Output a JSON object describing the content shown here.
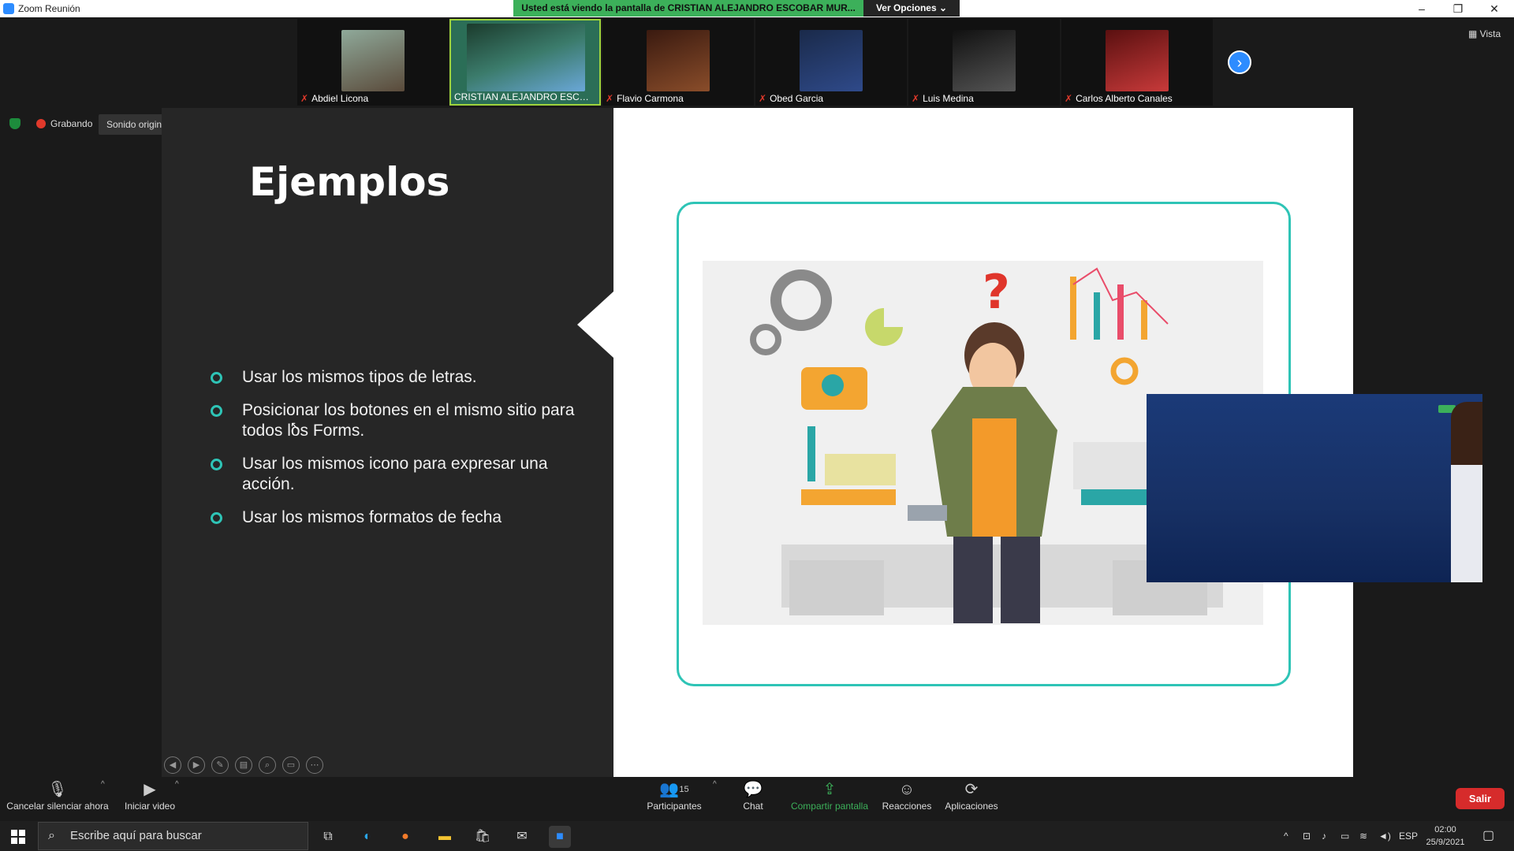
{
  "window": {
    "title": "Zoom Reunión",
    "minimize": "–",
    "restore": "❐",
    "close": "✕"
  },
  "banner": {
    "text": "Usted está viendo la pantalla de CRISTIAN ALEJANDRO ESCOBAR MUR...",
    "view_options": "Ver Opciones ⌄"
  },
  "participants_strip": [
    {
      "name": "Abdiel Licona",
      "muted": true,
      "color": "#5a4a3a"
    },
    {
      "name": "CRISTIAN ALEJANDRO ESCOB...",
      "muted": false,
      "color": "#3b7b6b"
    },
    {
      "name": "Flavio Carmona",
      "muted": true,
      "color": "#8a4d2a"
    },
    {
      "name": "Obed Garcia",
      "muted": true,
      "color": "#2f4a8a"
    },
    {
      "name": "Luis Medina",
      "muted": true,
      "color": "#2a2a2a"
    },
    {
      "name": "Carlos Alberto Canales",
      "muted": true,
      "color": "#c83a3a"
    }
  ],
  "vista_label": "Vista",
  "recording": {
    "label": "Grabando",
    "original_sound": "Sonido original: desactivado"
  },
  "slide": {
    "title": "Ejemplos",
    "bullets": [
      "Usar los mismos tipos de letras.",
      "Posicionar los botones en el mismo sitio para todos los Forms.",
      "Usar los mismos icono para expresar una acción.",
      "Usar los mismos formatos de fecha"
    ]
  },
  "bottom_bar": {
    "mute_label": "Cancelar silenciar ahora",
    "video_label": "Iniciar video",
    "participants_label": "Participantes",
    "participants_count": "15",
    "chat_label": "Chat",
    "share_label": "Compartir pantalla",
    "reactions_label": "Reacciones",
    "apps_label": "Aplicaciones",
    "leave_label": "Salir"
  },
  "taskbar": {
    "search_placeholder": "Escribe aquí para buscar",
    "language": "ESP",
    "time": "02:00",
    "date": "25/9/2021"
  },
  "colors": {
    "accent_teal": "#2ec4b6",
    "banner_green": "#3cb05a",
    "zoom_blue": "#2d8cff",
    "leave_red": "#d62b2b"
  }
}
